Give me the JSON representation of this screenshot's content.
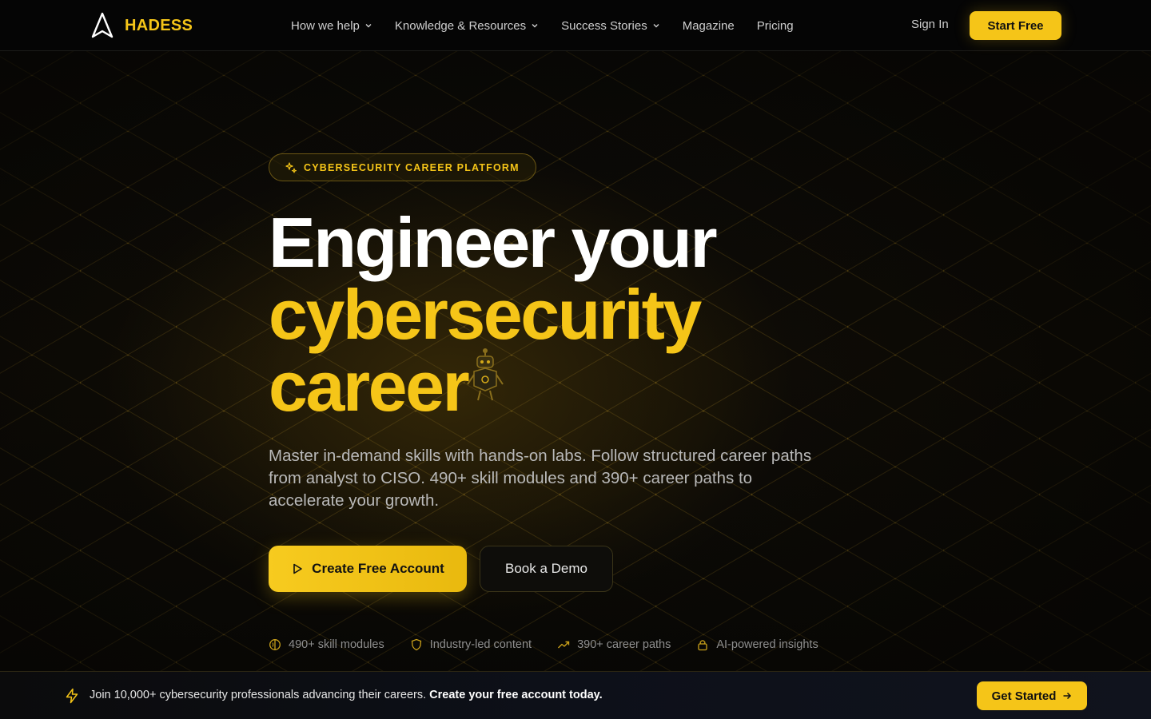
{
  "nav": {
    "brand": "HADESS",
    "items": [
      {
        "label": "How we help",
        "has_dropdown": true
      },
      {
        "label": "Knowledge & Resources",
        "has_dropdown": true
      },
      {
        "label": "Success Stories",
        "has_dropdown": true
      },
      {
        "label": "Magazine",
        "has_dropdown": false
      },
      {
        "label": "Pricing",
        "has_dropdown": false
      }
    ],
    "sign_in": "Sign In",
    "start_free": "Start Free"
  },
  "hero": {
    "badge": "CYBERSECURITY CAREER PLATFORM",
    "headline_line1": "Engineer your",
    "headline_line2": "cybersecurity",
    "headline_line3": "career",
    "subtitle": "Master in-demand skills with hands-on labs. Follow structured career paths from analyst to CISO. 490+ skill modules and 390+ career paths to accelerate your growth.",
    "cta_primary": "Create Free Account",
    "cta_secondary": "Book a Demo",
    "features": [
      {
        "icon": "brain-icon",
        "label": "490+ skill modules"
      },
      {
        "icon": "shield-icon",
        "label": "Industry-led content"
      },
      {
        "icon": "trending-up-icon",
        "label": "390+ career paths"
      },
      {
        "icon": "lock-icon",
        "label": "AI-powered insights"
      }
    ]
  },
  "banner": {
    "text": "Join 10,000+ cybersecurity professionals advancing their careers.",
    "emphasis": "Create your free account today.",
    "button": "Get Started"
  },
  "colors": {
    "accent": "#f5c518",
    "background": "#0a0906",
    "text_muted": "#b9b9b9"
  }
}
